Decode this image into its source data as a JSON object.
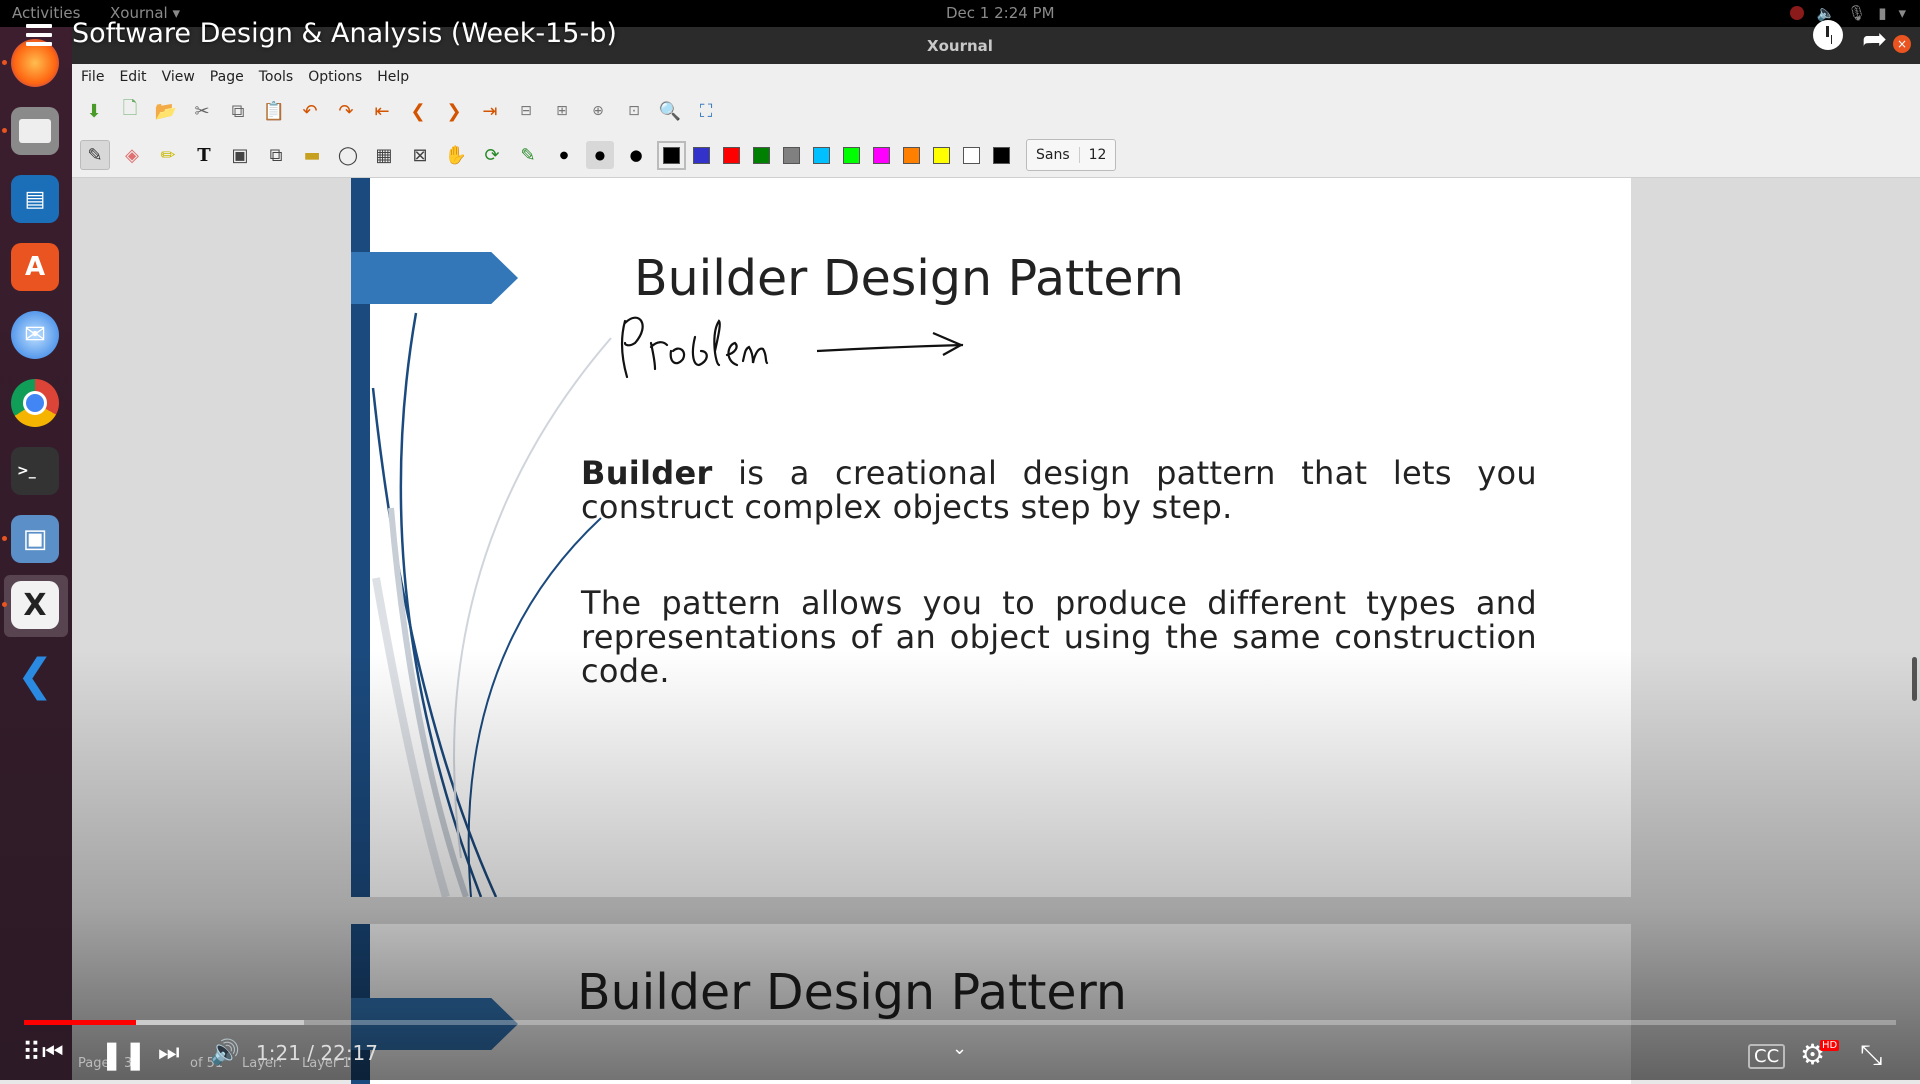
{
  "topbar": {
    "activities": "Activities",
    "app_name": "Xournal",
    "clock": "Dec 1  2:24 PM"
  },
  "window": {
    "title": "Xournal"
  },
  "video": {
    "title": "Software Design & Analysis (Week-15-b)",
    "time": "1:21 / 22:17",
    "progress_fraction": 0.06
  },
  "menu": {
    "file": "File",
    "edit": "Edit",
    "view": "View",
    "page": "Page",
    "tools": "Tools",
    "options": "Options",
    "help": "Help"
  },
  "toolbar": {
    "font_name": "Sans",
    "font_size": "12",
    "colors": [
      "#000000",
      "#3333cc",
      "#ff0000",
      "#008000",
      "#808080",
      "#00c0ff",
      "#00ff00",
      "#ff00ff",
      "#ff8000",
      "#ffff00",
      "#ffffff",
      "#000000"
    ]
  },
  "slide1": {
    "title": "Builder Design Pattern",
    "handwriting": "Problem",
    "para1_bold": "Builder",
    "para1_rest": " is a creational design pattern that lets you construct complex objects step by step.",
    "para2": "The pattern allows you to produce different types and representations of an object using the same construction code."
  },
  "slide2": {
    "title": "Builder Design Pattern"
  },
  "statusbar": {
    "page_label": "Page",
    "page_num": "30",
    "of_label": "of 51",
    "layer_label": "Layer:",
    "layer_value": "Layer 1"
  }
}
